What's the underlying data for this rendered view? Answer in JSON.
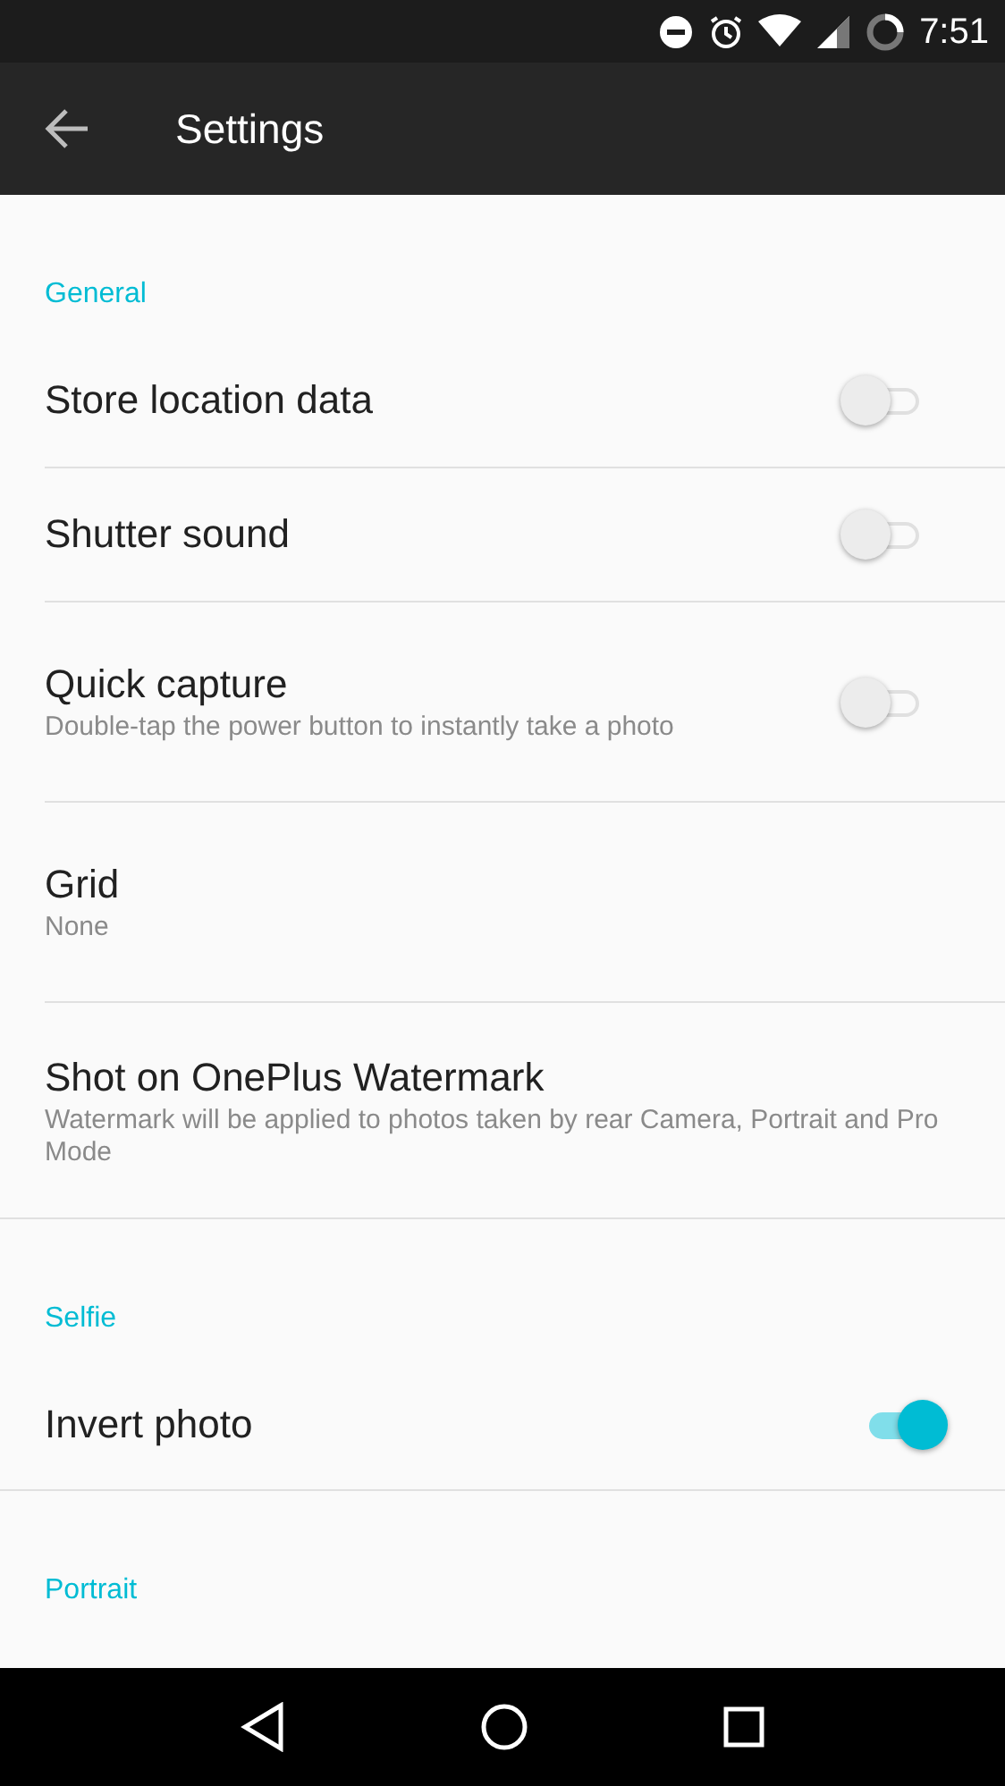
{
  "status_bar": {
    "time": "7:51"
  },
  "toolbar": {
    "title": "Settings"
  },
  "sections": [
    {
      "header": "General",
      "items": [
        {
          "kind": "switch",
          "title": "Store location data",
          "on": false
        },
        {
          "kind": "switch",
          "title": "Shutter sound",
          "on": false
        },
        {
          "kind": "switch",
          "title": "Quick capture",
          "summary": "Double-tap the power button to instantly take a photo",
          "on": false
        },
        {
          "kind": "text",
          "title": "Grid",
          "summary": "None"
        },
        {
          "kind": "text",
          "title": "Shot on OnePlus Watermark",
          "summary": "Watermark will be applied to photos taken by rear Camera, Portrait and Pro Mode"
        }
      ]
    },
    {
      "header": "Selfie",
      "items": [
        {
          "kind": "switch",
          "title": "Invert photo",
          "on": true
        }
      ]
    },
    {
      "header": "Portrait"
    }
  ]
}
